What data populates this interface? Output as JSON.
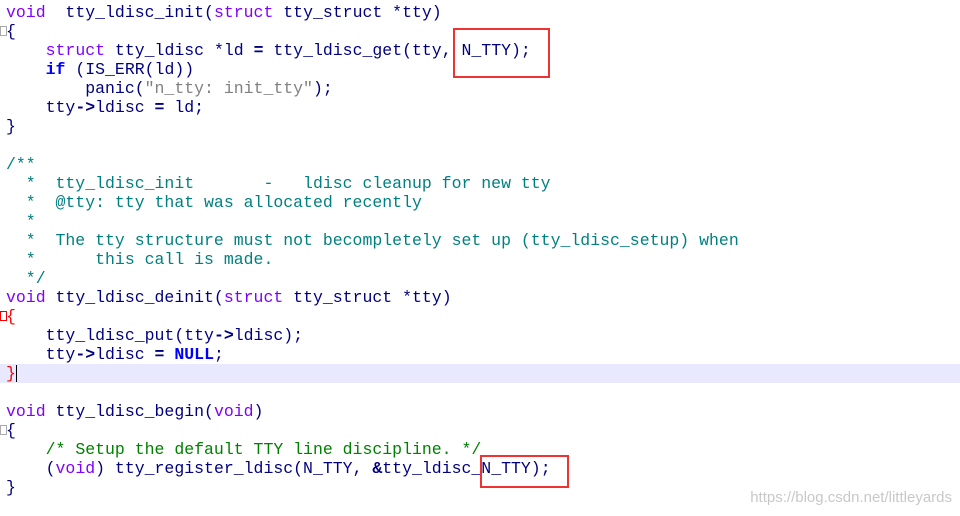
{
  "colors": {
    "keyword": "#8000ff",
    "control": "#0000ff",
    "text": "#000080",
    "string": "#808080",
    "doc_comment": "#008080",
    "comment": "#008000",
    "highlight": "#e8e8ff",
    "annotation_box": "#e33333"
  },
  "lines": [
    {
      "segs": [
        [
          "kw",
          "void"
        ],
        [
          "",
          "  tty_ldisc_init("
        ],
        [
          "kw",
          "struct"
        ],
        [
          "",
          " tty_struct *tty)"
        ]
      ]
    },
    {
      "fold": true,
      "segs": [
        [
          "",
          "{"
        ]
      ]
    },
    {
      "segs": [
        [
          "",
          "    "
        ],
        [
          "kw",
          "struct"
        ],
        [
          "",
          " tty_ldisc *ld "
        ],
        [
          "op",
          "="
        ],
        [
          "",
          " tty_ldisc_get(tty, N_TTY);"
        ]
      ]
    },
    {
      "segs": [
        [
          "",
          "    "
        ],
        [
          "kw2",
          "if"
        ],
        [
          "",
          " (IS_ERR(ld))"
        ]
      ]
    },
    {
      "segs": [
        [
          "",
          "        panic("
        ],
        [
          "str",
          "\"n_tty: init_tty\""
        ],
        [
          "",
          ");"
        ]
      ]
    },
    {
      "segs": [
        [
          "",
          "    tty"
        ],
        [
          "op",
          "->"
        ],
        [
          "",
          "ldisc "
        ],
        [
          "op",
          "="
        ],
        [
          "",
          " ld;"
        ]
      ]
    },
    {
      "segs": [
        [
          "",
          "}"
        ]
      ]
    },
    {
      "segs": []
    },
    {
      "segs": [
        [
          "doc",
          "/**"
        ]
      ]
    },
    {
      "segs": [
        [
          "doc",
          "  *  tty_ldisc_init       -   ldisc cleanup for new tty"
        ]
      ]
    },
    {
      "segs": [
        [
          "doc",
          "  *  @tty: tty that was allocated recently"
        ]
      ]
    },
    {
      "segs": [
        [
          "doc",
          "  *"
        ]
      ]
    },
    {
      "segs": [
        [
          "doc",
          "  *  The tty structure must not becompletely set up (tty_ldisc_setup) when"
        ]
      ]
    },
    {
      "segs": [
        [
          "doc",
          "  *      this call is made."
        ]
      ]
    },
    {
      "segs": [
        [
          "doc",
          "  */"
        ]
      ]
    },
    {
      "segs": [
        [
          "kw",
          "void"
        ],
        [
          "",
          " tty_ldisc_deinit("
        ],
        [
          "kw",
          "struct"
        ],
        [
          "",
          " tty_struct *tty)"
        ]
      ]
    },
    {
      "fold": true,
      "red": true,
      "segs": [
        [
          "brace-red",
          "{"
        ]
      ]
    },
    {
      "segs": [
        [
          "",
          "    tty_ldisc_put(tty"
        ],
        [
          "op",
          "->"
        ],
        [
          "",
          "ldisc);"
        ]
      ]
    },
    {
      "segs": [
        [
          "",
          "    tty"
        ],
        [
          "op",
          "->"
        ],
        [
          "",
          "ldisc "
        ],
        [
          "op",
          "="
        ],
        [
          "",
          " "
        ],
        [
          "kw2",
          "NULL"
        ],
        [
          "",
          ";"
        ]
      ]
    },
    {
      "hl": true,
      "caret": true,
      "segs": [
        [
          "brace-red",
          "}"
        ]
      ]
    },
    {
      "segs": []
    },
    {
      "segs": [
        [
          "kw",
          "void"
        ],
        [
          "",
          " tty_ldisc_begin("
        ],
        [
          "kw",
          "void"
        ],
        [
          "",
          ")"
        ]
      ]
    },
    {
      "fold": true,
      "segs": [
        [
          "",
          "{"
        ]
      ]
    },
    {
      "segs": [
        [
          "",
          "    "
        ],
        [
          "cm",
          "/* Setup the default TTY line discipline. */"
        ]
      ]
    },
    {
      "segs": [
        [
          "",
          "    ("
        ],
        [
          "kw",
          "void"
        ],
        [
          "",
          ") tty_register_ldisc(N_TTY, "
        ],
        [
          "op",
          "&"
        ],
        [
          "",
          "tty_ldisc_N_TTY);"
        ]
      ]
    },
    {
      "segs": [
        [
          "",
          "}"
        ]
      ]
    }
  ],
  "watermark": "https://blog.csdn.net/littleyards"
}
